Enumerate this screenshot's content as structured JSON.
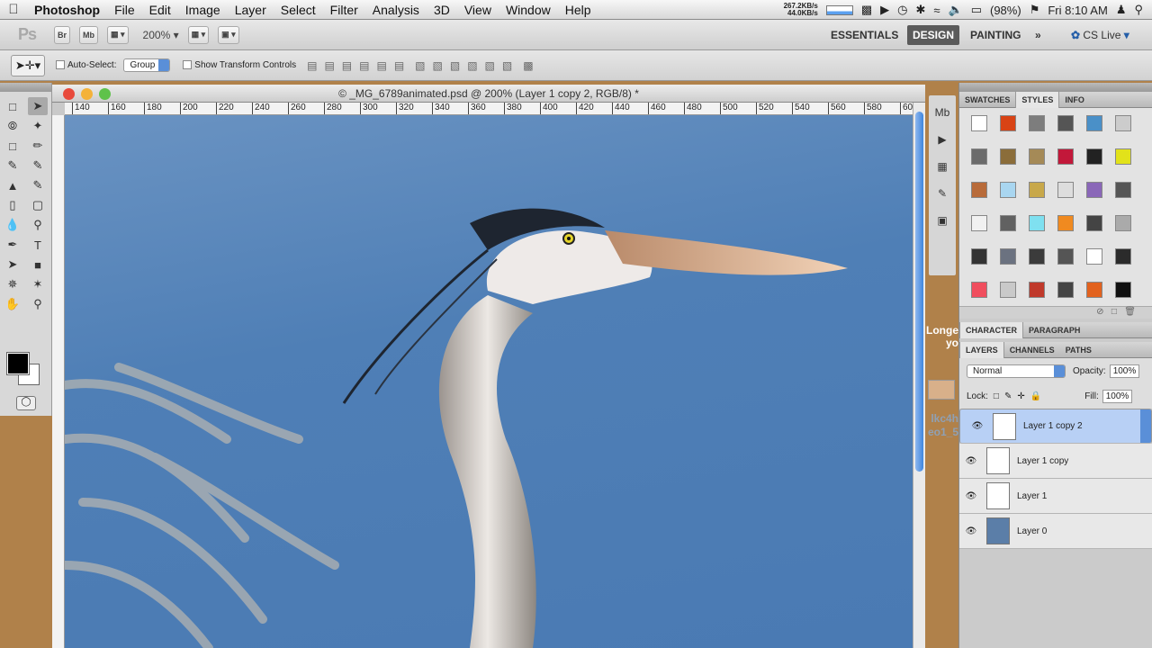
{
  "menubar": {
    "app_name": "Photoshop",
    "items": [
      "File",
      "Edit",
      "Image",
      "Layer",
      "Select",
      "Filter",
      "Analysis",
      "3D",
      "View",
      "Window",
      "Help"
    ],
    "net_up": "267.2KB/s",
    "net_down": "44.0KB/s",
    "battery": "(98%)",
    "clock": "Fri 8:10 AM"
  },
  "appbar": {
    "logo": "Ps",
    "br": "Br",
    "mb": "Mb",
    "zoom": "200%",
    "workspaces": [
      "ESSENTIALS",
      "DESIGN",
      "PAINTING"
    ],
    "active_workspace": "DESIGN",
    "cs_live": "CS Live"
  },
  "options": {
    "auto_select_label": "Auto-Select:",
    "auto_select_value": "Group",
    "show_transform_label": "Show Transform Controls"
  },
  "document": {
    "title": "© _MG_6789animated.psd @ 200% (Layer 1 copy 2, RGB/8) *",
    "ruler_ticks": [
      "140",
      "160",
      "180",
      "200",
      "220",
      "240",
      "260",
      "280",
      "300",
      "320",
      "340",
      "360",
      "380",
      "400",
      "420",
      "440",
      "460",
      "480",
      "500",
      "520",
      "540",
      "560",
      "580",
      "60"
    ]
  },
  "panels": {
    "top_tabs": [
      "SWATCHES",
      "STYLES",
      "INFO"
    ],
    "top_active": "STYLES",
    "char_tabs": [
      "CHARACTER",
      "PARAGRAPH"
    ],
    "char_active": "CHARACTER",
    "layer_tabs": [
      "LAYERS",
      "CHANNELS",
      "PATHS"
    ],
    "layer_active": "LAYERS",
    "blend_mode": "Normal",
    "opacity_label": "Opacity:",
    "opacity_value": "100%",
    "lock_label": "Lock:",
    "fill_label": "Fill:",
    "fill_value": "100%",
    "layers": [
      "Layer 1 copy 2",
      "Layer 1 copy",
      "Layer 1",
      "Layer 0"
    ],
    "selected_layer": "Layer 1 copy 2"
  },
  "bg_text": {
    "line1": "Longe",
    "line2": "yo",
    "line3": "lkc4h",
    "line4": "eo1_5"
  },
  "colors": {
    "style_swatches": [
      "#ffffff",
      "#d84315",
      "#7d7d7d",
      "#555555",
      "#4a90c8",
      "#cccccc",
      "#6b6b6b",
      "#8b6d3a",
      "#a58a57",
      "#c2183a",
      "#222222",
      "#e2e21a",
      "#b86b3a",
      "#a9d6f0",
      "#c8a84a",
      "#dddddd",
      "#8a67b8",
      "#555555",
      "#f1f1f1",
      "#616161",
      "#7fe0f0",
      "#f08a20",
      "#444444",
      "#aaaaaa",
      "#333333",
      "#6b7280",
      "#3b3b3b",
      "#555555",
      "#ffffff",
      "#2b2b2b",
      "#f04e5e",
      "#c9c9c9",
      "#c0392b",
      "#444444",
      "#e2621e",
      "#111111"
    ]
  }
}
